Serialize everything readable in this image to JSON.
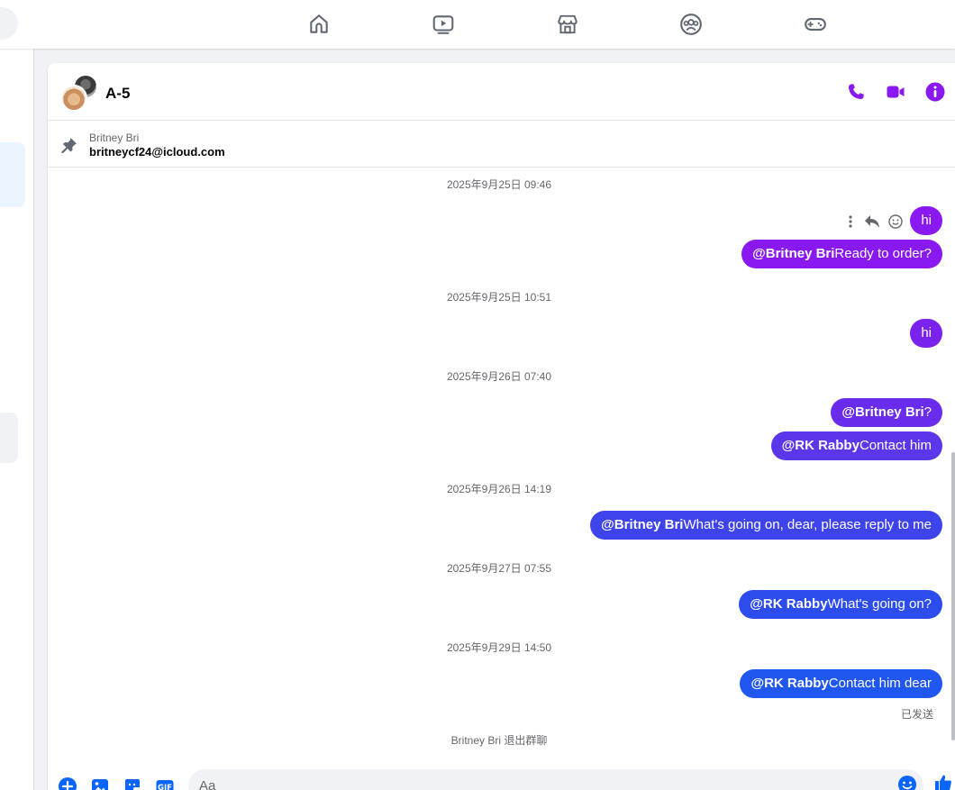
{
  "nav": {
    "items": [
      {
        "name": "home-icon"
      },
      {
        "name": "video-icon"
      },
      {
        "name": "marketplace-icon"
      },
      {
        "name": "groups-icon"
      },
      {
        "name": "gaming-icon"
      }
    ]
  },
  "colors": {
    "accent": "#8a18f0",
    "bubble_purple": "#8a18f0",
    "bubble_violet": "#5b3ae8",
    "bubble_blue": "#2357f0",
    "icon_gray": "#606770"
  },
  "chat": {
    "title": "A-5",
    "header_icons": [
      "phone-icon",
      "video-call-icon",
      "info-icon"
    ],
    "pinned": {
      "sender": "Britney Bri",
      "text": "britneycf24@icloud.com"
    },
    "timestamps": [
      "2025年9月25日 09:46",
      "2025年9月25日 10:51",
      "2025年9月26日 07:40",
      "2025年9月26日 14:19",
      "2025年9月27日 07:55",
      "2025年9月29日 14:50"
    ],
    "messages": [
      {
        "mention": "",
        "text": "hi"
      },
      {
        "mention": "@Britney Bri",
        "text": "Ready to order?"
      },
      {
        "mention": "",
        "text": "hi"
      },
      {
        "mention": "@Britney Bri",
        "text": "?"
      },
      {
        "mention": "@RK Rabby",
        "text": "Contact him"
      },
      {
        "mention": "@Britney Bri",
        "text": "What's going on, dear, please reply to me"
      },
      {
        "mention": "@RK Rabby",
        "text": "What's going on?"
      },
      {
        "mention": "@RK Rabby",
        "text": "Contact him dear"
      }
    ],
    "status": "已发送",
    "system_note": "Britney Bri 退出群聊",
    "composer": {
      "placeholder": "Aa",
      "icons": [
        "add-icon",
        "photo-icon",
        "sticker-icon",
        "gif-icon",
        "emoji-icon",
        "like-icon"
      ]
    }
  }
}
